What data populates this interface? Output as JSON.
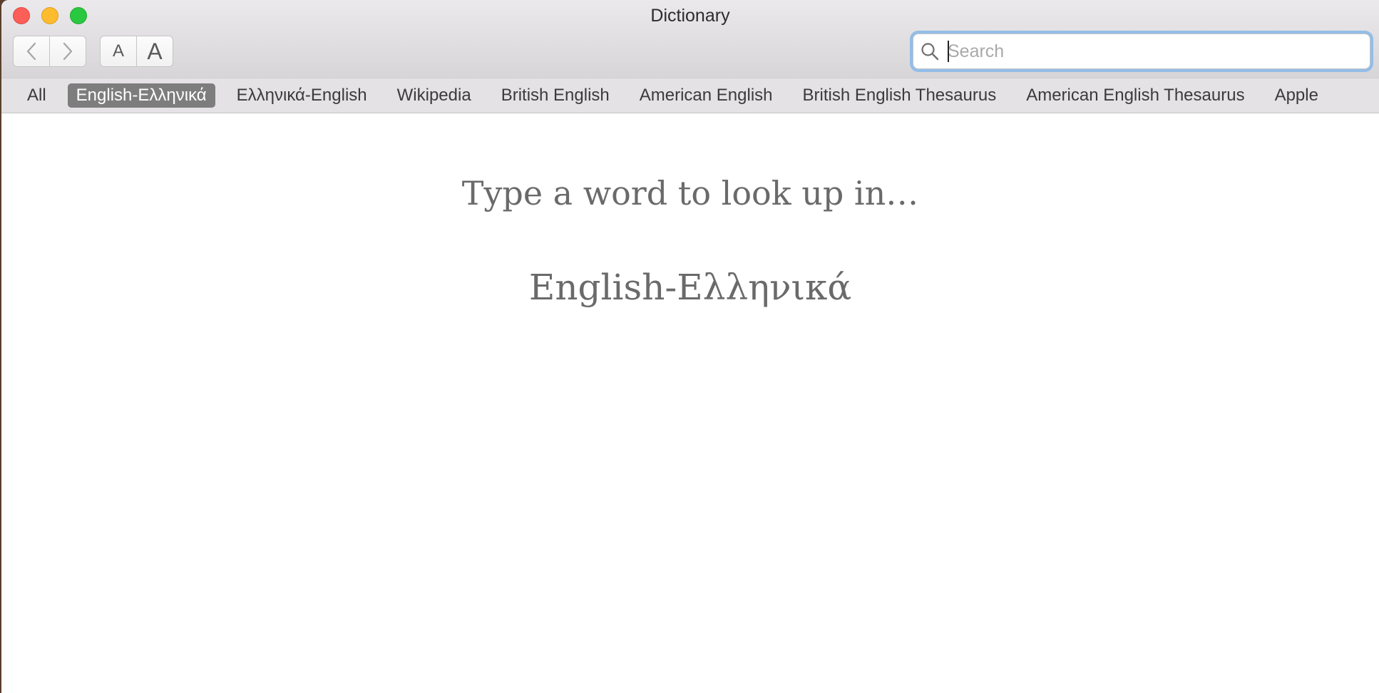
{
  "window": {
    "title": "Dictionary"
  },
  "toolbar": {
    "back_icon": "chevron-left-icon",
    "forward_icon": "chevron-right-icon",
    "font_smaller_label": "A",
    "font_larger_label": "A"
  },
  "search": {
    "placeholder": "Search",
    "value": "",
    "icon": "search-icon",
    "focus_color": "#93bde9"
  },
  "tabs": [
    {
      "label": "All",
      "active": false
    },
    {
      "label": "English-Ελληνικά",
      "active": true
    },
    {
      "label": "Ελληνικά-English",
      "active": false
    },
    {
      "label": "Wikipedia",
      "active": false
    },
    {
      "label": "British English",
      "active": false
    },
    {
      "label": "American English",
      "active": false
    },
    {
      "label": "British English Thesaurus",
      "active": false
    },
    {
      "label": "American English Thesaurus",
      "active": false
    },
    {
      "label": "Apple",
      "active": false
    }
  ],
  "content": {
    "prompt": "Type a word to look up in…",
    "dictionary_name": "English-Ελληνικά"
  },
  "colors": {
    "close": "#fc5f57",
    "minimize": "#fdbc2e",
    "maximize": "#2ac840",
    "active_tab": "#7d7d7d"
  }
}
